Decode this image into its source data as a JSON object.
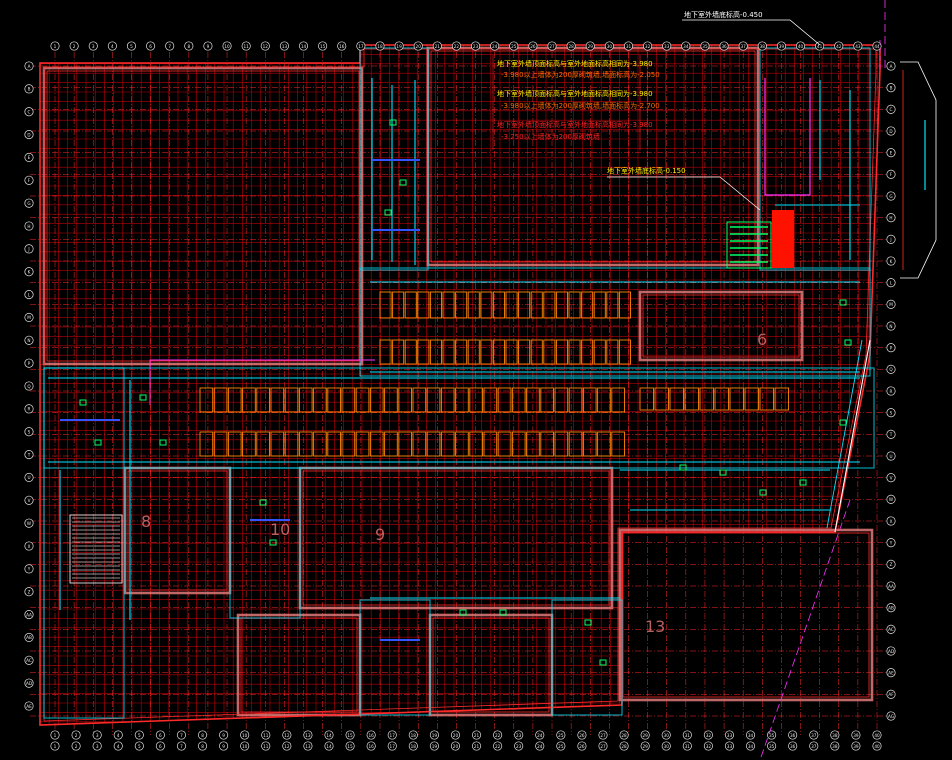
{
  "drawing": {
    "colors": {
      "background": "#000000",
      "outline": "#ff2a2a",
      "grid": "#b8000a",
      "axis_bubble": "#e8e8e8",
      "wall": "#e07a7a",
      "pipe_cyan": "#00e5ff",
      "pipe_blue": "#3355ff",
      "magenta": "#ff33ff",
      "green": "#00ff66",
      "orange": "#ff8800",
      "yellow": "#ffee00",
      "equipment_red": "#ff1100",
      "leader": "#ffffff"
    },
    "top_annotation": "地下室外墙底标高-0.450",
    "red_notes": [
      "地下室外墙顶面标高与室外地面标高相同为-3.980",
      "-3.980以上墙体为200厚砌筑墙,墙面标高为-2.050",
      "地下室外墙顶面标高与室外地面标高相同为-3.980",
      "-3.980以上墙体为200厚砌筑墙,墙面标高为-2.700",
      "地下室外墙顶面标高与室外地面标高相同为-3.980",
      "-3.250以上墙体为200厚砌筑墙"
    ],
    "mid_annotation": "地下室外墙底标高-0.150",
    "zone_labels": [
      "6",
      "8",
      "9",
      "10",
      "13"
    ],
    "top_axis_labels": [
      "1",
      "2",
      "3",
      "4",
      "5",
      "6",
      "7",
      "8",
      "9",
      "10",
      "11",
      "12",
      "13",
      "14",
      "15",
      "16",
      "17",
      "18",
      "19",
      "20",
      "21",
      "22",
      "23",
      "24",
      "25",
      "26",
      "27",
      "28",
      "29",
      "30",
      "31",
      "32",
      "33",
      "34",
      "35",
      "36",
      "37",
      "38",
      "39",
      "40",
      "41",
      "42",
      "43",
      "44"
    ],
    "bottom_axis_labels": [
      "1",
      "2",
      "3",
      "4",
      "5",
      "6",
      "7",
      "8",
      "9",
      "10",
      "11",
      "12",
      "13",
      "14",
      "15",
      "16",
      "17",
      "18",
      "19",
      "20",
      "21",
      "22",
      "23",
      "24",
      "25",
      "26",
      "27",
      "28",
      "29",
      "30",
      "31",
      "32",
      "33",
      "34",
      "35",
      "36",
      "37",
      "38",
      "39",
      "40"
    ],
    "left_axis_labels": [
      "A",
      "B",
      "C",
      "D",
      "E",
      "F",
      "G",
      "H",
      "J",
      "K",
      "L",
      "M",
      "N",
      "P",
      "Q",
      "R",
      "S",
      "T",
      "U",
      "V",
      "W",
      "X",
      "Y",
      "Z",
      "AA",
      "AB",
      "AC",
      "AD",
      "AE"
    ],
    "right_axis_labels": [
      "A",
      "B",
      "C",
      "D",
      "E",
      "F",
      "G",
      "H",
      "J",
      "K",
      "L",
      "M",
      "N",
      "P",
      "Q",
      "R",
      "S",
      "T",
      "U",
      "V",
      "W",
      "X",
      "Y",
      "Z",
      "AA",
      "AB",
      "AC",
      "AD",
      "AE",
      "AF",
      "AG"
    ]
  }
}
